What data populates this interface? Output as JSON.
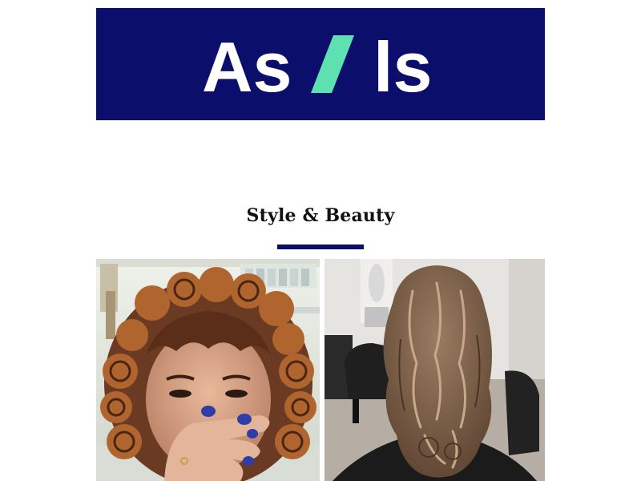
{
  "header": {
    "brand_left": "As",
    "brand_right": "ls",
    "colors": {
      "banner": "#0b0f6b",
      "brand_text": "#ffffff",
      "slash": "#5fe0b0"
    }
  },
  "section": {
    "title": "Style & Beauty",
    "accent_color": "#0b0f6b"
  },
  "photos": [
    {
      "name": "curly-hair-before-photo"
    },
    {
      "name": "wavy-hair-after-photo"
    }
  ]
}
